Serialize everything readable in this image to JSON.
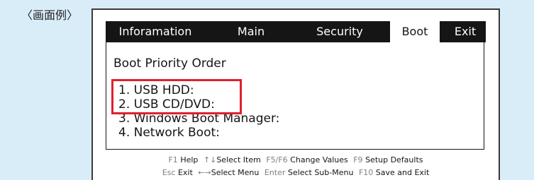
{
  "caption": "〈画面例〉",
  "menu": {
    "tabs": [
      {
        "label": "Inforamation",
        "active": false
      },
      {
        "label": "Main",
        "active": false
      },
      {
        "label": "Security",
        "active": false
      },
      {
        "label": "Boot",
        "active": true
      },
      {
        "label": "Exit",
        "active": false
      }
    ]
  },
  "boot": {
    "title": "Boot Priority Order",
    "items": [
      "1. USB HDD:",
      "2. USB CD/DVD:",
      "3. Windows Boot Manager:",
      "4. Network Boot:"
    ]
  },
  "help": {
    "row1": [
      {
        "key": "F1",
        "action": "Help"
      },
      {
        "key": "↑↓",
        "action": "Select Item"
      },
      {
        "key": "F5/F6",
        "action": "Change Values"
      },
      {
        "key": "F9",
        "action": "Setup Defaults"
      }
    ],
    "row2": [
      {
        "key": "Esc",
        "action": "Exit"
      },
      {
        "key": "←→",
        "action": "Select Menu"
      },
      {
        "key": "Enter",
        "action": "Select Sub-Menu"
      },
      {
        "key": "F10",
        "action": "Save and Exit"
      }
    ]
  },
  "colors": {
    "background": "#d9edf9",
    "menubar": "#151515",
    "highlight_box": "#e0202c",
    "key_text": "#7f7f7f"
  }
}
